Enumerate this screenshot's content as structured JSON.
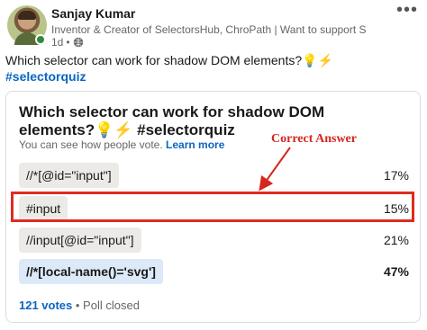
{
  "post": {
    "author_name": "Sanjay Kumar",
    "author_headline": "Inventor & Creator of SelectorsHub, ChroPath | Want to support Selectors...",
    "timestamp": "1d",
    "visibility_icon": "globe-icon",
    "more_icon": "more-icon",
    "more_label": "•••",
    "text": "Which selector can work for shadow DOM elements?💡⚡",
    "hashtag": "#selectorquiz"
  },
  "poll": {
    "question": "Which selector can work for shadow DOM elements?💡⚡ #selectorquiz",
    "visibility_note": "You can see how people vote.",
    "learn_more": "Learn more",
    "options": [
      {
        "label": "//*[@id=\"input\"]",
        "percent_text": "17%",
        "percent": 17
      },
      {
        "label": "#input",
        "percent_text": "15%",
        "percent": 15
      },
      {
        "label": "//input[@id=\"input\"]",
        "percent_text": "21%",
        "percent": 21
      },
      {
        "label": "//*[local-name()='svg']",
        "percent_text": "47%",
        "percent": 47
      }
    ],
    "votes": "121 votes",
    "status": "• Poll closed"
  },
  "annotation": {
    "text": "Correct Answer",
    "color": "#e02b20"
  },
  "colors": {
    "link": "#0a66c2",
    "bar": "#eceae6",
    "winner_bar": "#dce9f8",
    "presence": "#2f8a3e"
  }
}
